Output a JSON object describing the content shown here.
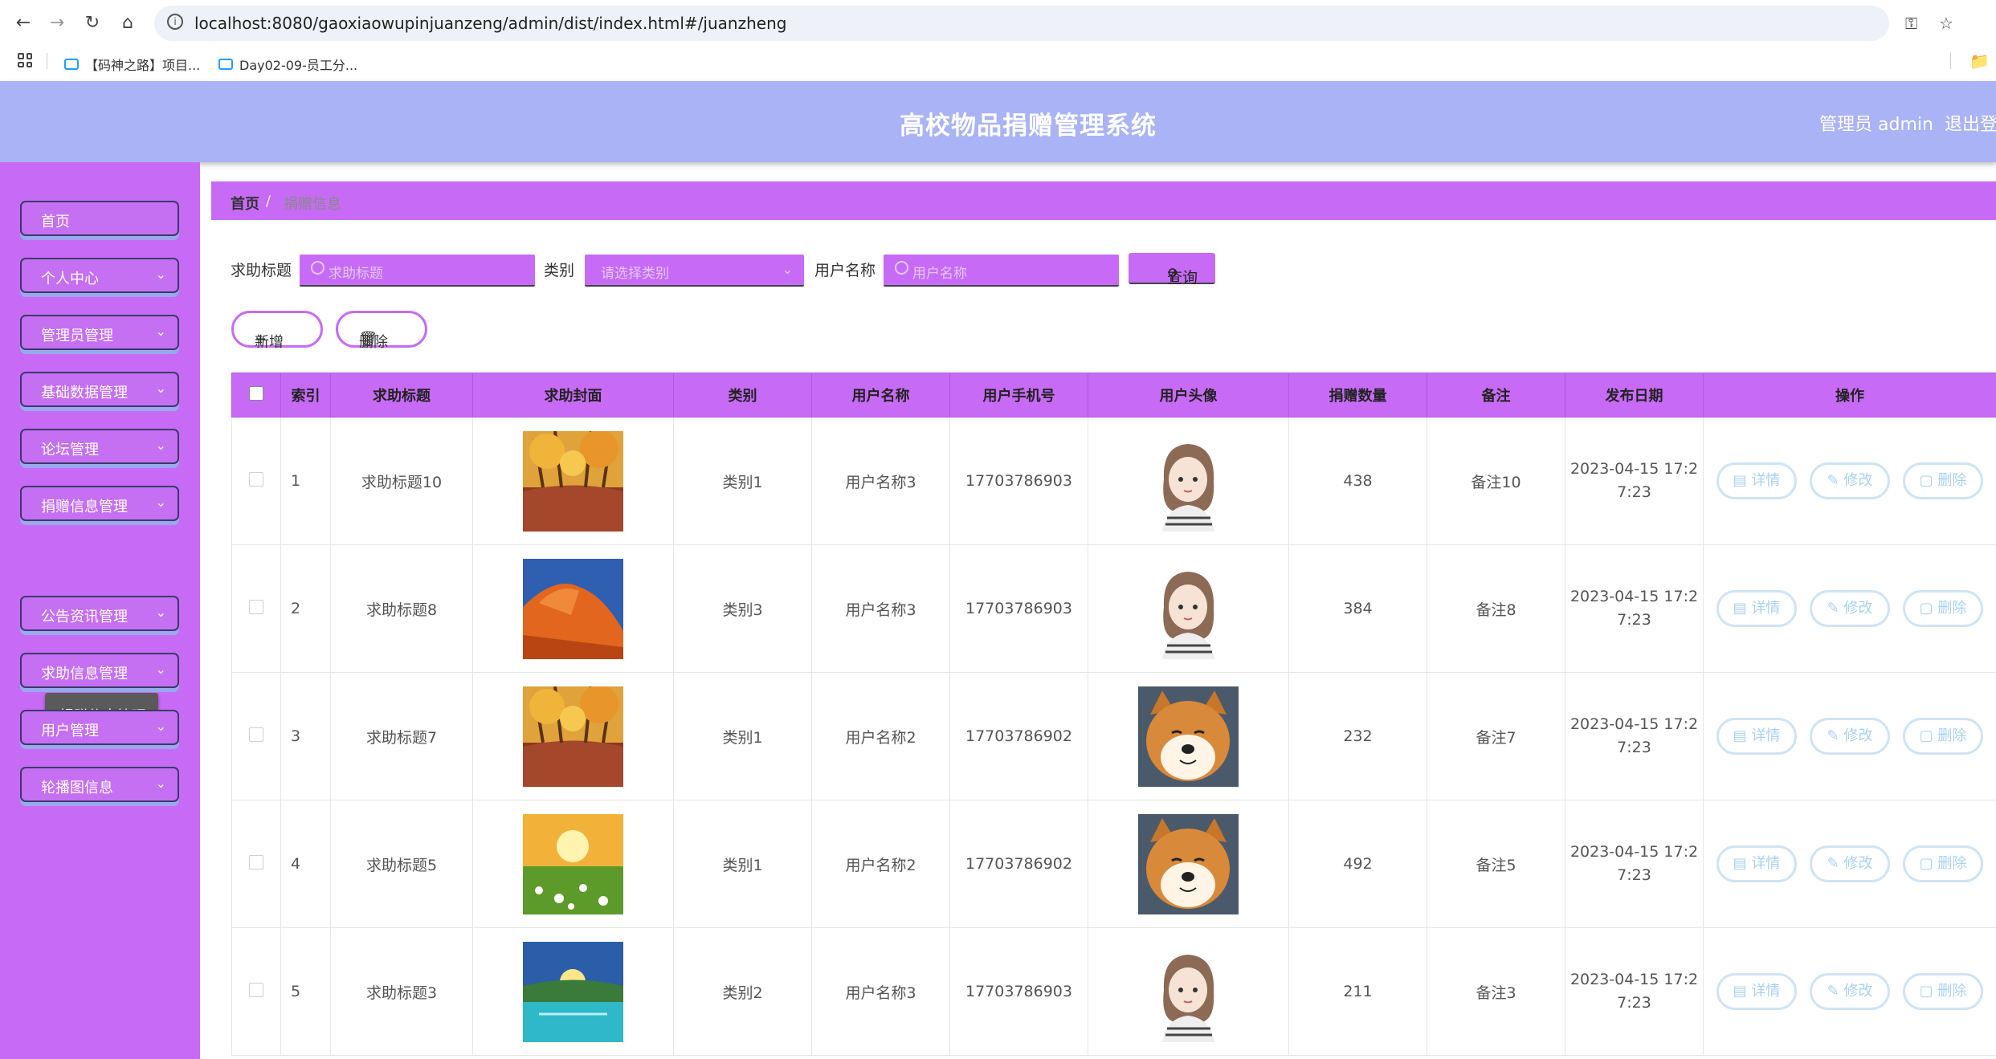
{
  "browser": {
    "url": "localhost:8080/gaoxiaowupinjuanzeng/admin/dist/index.html#/juanzheng",
    "bookmarks": [
      "【码神之路】项目...",
      "Day02-09-员工分..."
    ]
  },
  "header": {
    "title": "高校物品捐赠管理系统",
    "admin_label": "管理员 admin",
    "logout": "退出登"
  },
  "sidebar": {
    "items": [
      {
        "label": "首页"
      },
      {
        "label": "个人中心"
      },
      {
        "label": "管理员管理"
      },
      {
        "label": "基础数据管理"
      },
      {
        "label": "论坛管理"
      },
      {
        "label": "捐赠信息管理"
      },
      {
        "label": "公告资讯管理"
      },
      {
        "label": "求助信息管理"
      },
      {
        "label": "用户管理"
      },
      {
        "label": "轮播图信息"
      }
    ],
    "submenu_item": "捐赠信息管理"
  },
  "breadcrumb": {
    "home": "首页",
    "separator": "/",
    "current": "捐赠信息"
  },
  "search": {
    "title_label": "求助标题",
    "title_placeholder": "求助标题",
    "category_label": "类别",
    "category_placeholder": "请选择类别",
    "username_label": "用户名称",
    "username_placeholder": "用户名称",
    "query_button": "查询"
  },
  "actions": {
    "add": "新增",
    "delete": "删除"
  },
  "table": {
    "columns": [
      "索引",
      "求助标题",
      "求助封面",
      "类别",
      "用户名称",
      "用户手机号",
      "用户头像",
      "捐赠数量",
      "备注",
      "发布日期",
      "操作"
    ],
    "rows": [
      {
        "index": "1",
        "title": "求助标题10",
        "cover": "autumn",
        "category": "类别1",
        "username": "用户名称3",
        "phone": "17703786903",
        "avatar": "girl",
        "amount": "438",
        "note": "备注10",
        "date_line1": "2023-04-15 17:2",
        "date_line2": "7:23"
      },
      {
        "index": "2",
        "title": "求助标题8",
        "cover": "mountain",
        "category": "类别3",
        "username": "用户名称3",
        "phone": "17703786903",
        "avatar": "girl",
        "amount": "384",
        "note": "备注8",
        "date_line1": "2023-04-15 17:2",
        "date_line2": "7:23"
      },
      {
        "index": "3",
        "title": "求助标题7",
        "cover": "autumn",
        "category": "类别1",
        "username": "用户名称2",
        "phone": "17703786902",
        "avatar": "dog",
        "amount": "232",
        "note": "备注7",
        "date_line1": "2023-04-15 17:2",
        "date_line2": "7:23"
      },
      {
        "index": "4",
        "title": "求助标题5",
        "cover": "meadow",
        "category": "类别1",
        "username": "用户名称2",
        "phone": "17703786902",
        "avatar": "dog",
        "amount": "492",
        "note": "备注5",
        "date_line1": "2023-04-15 17:2",
        "date_line2": "7:23"
      },
      {
        "index": "5",
        "title": "求助标题3",
        "cover": "lake",
        "category": "类别2",
        "username": "用户名称3",
        "phone": "17703786903",
        "avatar": "girl",
        "amount": "211",
        "note": "备注3",
        "date_line1": "2023-04-15 17:2",
        "date_line2": "7:23"
      }
    ],
    "row_actions": {
      "detail": "详情",
      "edit": "修改",
      "delete": "删除"
    }
  },
  "colors": {
    "primary_purple": "#c76bf6",
    "header_blue": "#a9b3f6",
    "op_button_text": "#a8d2f0"
  }
}
